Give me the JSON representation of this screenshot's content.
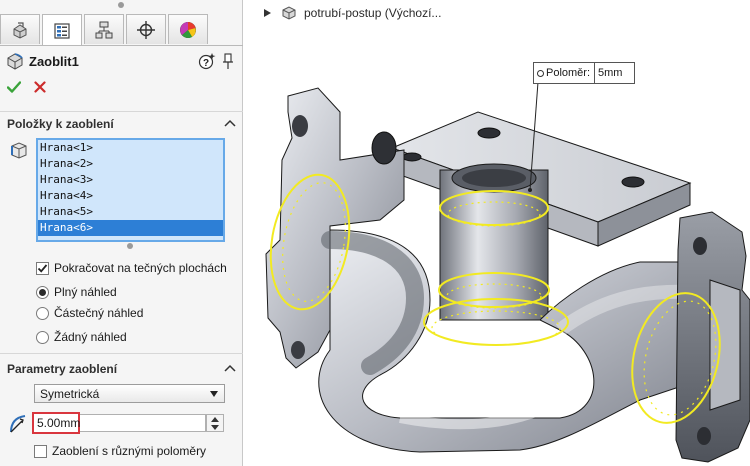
{
  "tabs": [
    {
      "name": "feature-manager",
      "active": false
    },
    {
      "name": "property-manager",
      "active": true
    },
    {
      "name": "configuration-manager",
      "active": false
    },
    {
      "name": "dimxpert-manager",
      "active": false
    },
    {
      "name": "display-manager",
      "active": false
    }
  ],
  "feature": {
    "title": "Zaoblit1",
    "ok_icon": "check-icon",
    "cancel_icon": "x-icon"
  },
  "items_group": {
    "title": "Položky k zaoblení",
    "edges": [
      "Hrana<1>",
      "Hrana<2>",
      "Hrana<3>",
      "Hrana<4>",
      "Hrana<5>",
      "Hrana<6>"
    ],
    "selected_index": 5,
    "tangent_label": "Pokračovat na tečných plochách",
    "tangent_checked": true,
    "preview_options": [
      "Plný náhled",
      "Částečný náhled",
      "Žádný náhled"
    ],
    "preview_selected": 0
  },
  "params_group": {
    "title": "Parametry zaoblení",
    "type_value": "Symetrická",
    "radius_value": "5.00mm",
    "multi_radius_label": "Zaoblení s různými poloměry",
    "multi_radius_checked": false
  },
  "graphics": {
    "tree_label": "potrubí-postup  (Výchozí...",
    "callout_label": "Poloměr:",
    "callout_value": "5mm"
  },
  "colors": {
    "selection_list_bg": "#d0e6fb",
    "selection_highlight": "#2d7fd6",
    "preview_yellow": "#f2ea22",
    "ok_green": "#3aa33a",
    "cancel_red": "#cc2b2b",
    "radius_box_border": "#d9363e"
  }
}
